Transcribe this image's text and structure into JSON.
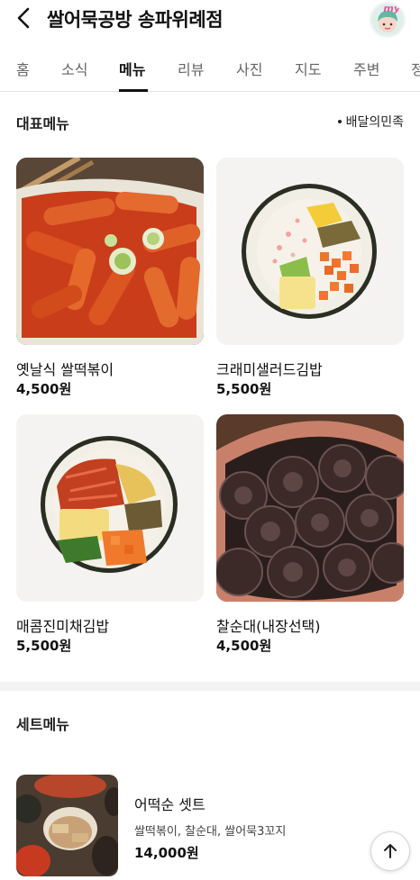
{
  "header": {
    "title": "쌀어묵공방 송파위례점",
    "my_label": "my"
  },
  "tabs": [
    {
      "label": "홈"
    },
    {
      "label": "소식"
    },
    {
      "label": "메뉴"
    },
    {
      "label": "리뷰"
    },
    {
      "label": "사진"
    },
    {
      "label": "지도"
    },
    {
      "label": "주변"
    },
    {
      "label": "정"
    }
  ],
  "active_tab": "메뉴",
  "main_menu": {
    "title": "대표메뉴",
    "source": "배달의민족",
    "items": [
      {
        "name": "옛날식 쌀떡볶이",
        "price": "4,500원"
      },
      {
        "name": "크래미샐러드김밥",
        "price": "5,500원"
      },
      {
        "name": "매콤진미채김밥",
        "price": "5,500원"
      },
      {
        "name": "찰순대(내장선택)",
        "price": "4,500원"
      }
    ]
  },
  "set_menu": {
    "title": "세트메뉴",
    "items": [
      {
        "name": "어떡순 셋트",
        "description": "쌀떡볶이, 찰순대, 쌀어묵3꼬지",
        "price": "14,000원"
      }
    ]
  },
  "icons": {
    "back": "chevron-left-icon",
    "scroll_top": "arrow-up-icon"
  }
}
